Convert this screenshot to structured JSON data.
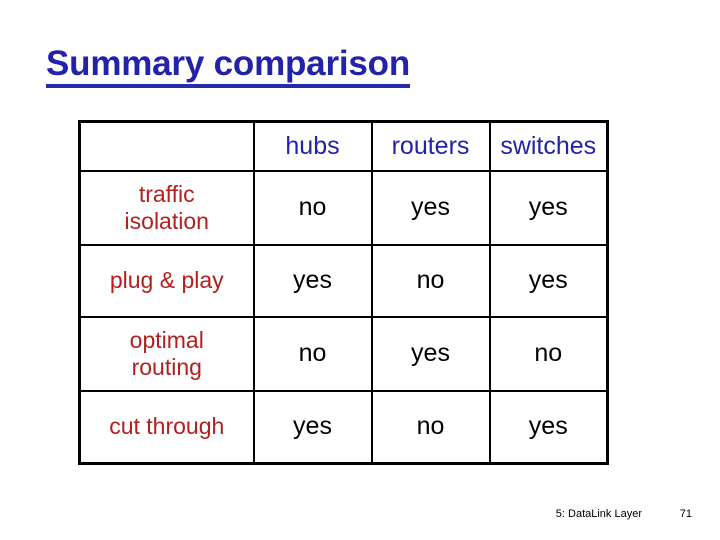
{
  "slide": {
    "title": "Summary comparison",
    "title_color": "#2222AA",
    "label_color": "#B11F1F",
    "value_color": "#000000",
    "background": "#FFFFFF"
  },
  "table": {
    "corner_label": "",
    "columns": [
      "hubs",
      "routers",
      "switches"
    ],
    "rows": [
      {
        "label": "traffic isolation",
        "label_line1": "traffic",
        "label_line2": "isolation",
        "values": [
          "no",
          "yes",
          "yes"
        ]
      },
      {
        "label": "plug & play",
        "label_line1": "plug & play",
        "label_line2": "",
        "values": [
          "yes",
          "no",
          "yes"
        ]
      },
      {
        "label": "optimal routing",
        "label_line1": "optimal",
        "label_line2": "routing",
        "values": [
          "no",
          "yes",
          "no"
        ]
      },
      {
        "label": "cut through",
        "label_line1": "cut through",
        "label_line2": "",
        "values": [
          "yes",
          "no",
          "yes"
        ]
      }
    ]
  },
  "footer": {
    "section": "5: DataLink Layer",
    "page": "71"
  }
}
